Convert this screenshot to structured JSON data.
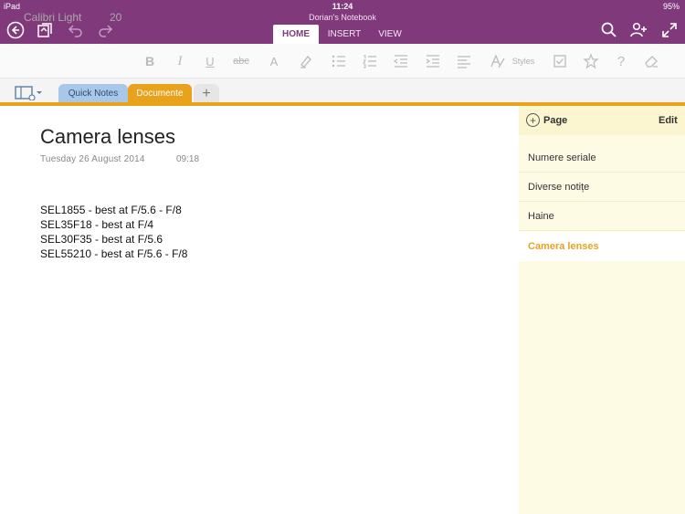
{
  "status_bar": {
    "device": "iPad",
    "time": "11:24",
    "battery": "95%"
  },
  "notebook": {
    "title": "Dorian's Notebook"
  },
  "ribbon_tabs": [
    "HOME",
    "INSERT",
    "VIEW"
  ],
  "ribbon": {
    "font_name": "Calibri Light",
    "font_size": "20",
    "styles_label": "Styles",
    "strike_label": "abc",
    "color_label": "A"
  },
  "sections": {
    "quick": "Quick Notes",
    "current": "Documente",
    "add": "+"
  },
  "page": {
    "title": "Camera lenses",
    "date": "Tuesday  26 August 2014",
    "time": "09:18",
    "lines": [
      "SEL1855 - best at F/5.6 - F/8",
      "SEL35F18 - best at F/4",
      "SEL30F35 - best at F/5.6",
      "SEL55210 - best at F/5.6 - F/8"
    ]
  },
  "pages_panel": {
    "add_label": "Page",
    "edit_label": "Edit",
    "items": [
      "Numere seriale",
      "Diverse notițe",
      "Haine",
      "Camera lenses"
    ]
  },
  "colors": {
    "accent": "#80397b",
    "section": "#e8a21b",
    "quick_notes": "#a9c7e8",
    "pages_bg": "#fdfbe4"
  }
}
